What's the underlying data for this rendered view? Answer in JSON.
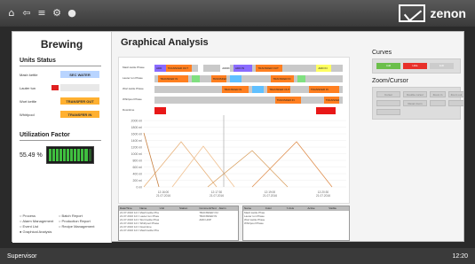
{
  "topbar": {
    "icons": [
      "home-icon",
      "back-icon",
      "menu-icon",
      "gear-icon",
      "user-icon"
    ],
    "brand": "zenon"
  },
  "left": {
    "title": "Brewing",
    "units_title": "Units Status",
    "units": [
      {
        "label": "Mash kettle",
        "status": "SEC WATER",
        "color": "#b8d4ff"
      },
      {
        "label": "Lauter tun",
        "status": "",
        "color": "#e8e8e8",
        "indicator": "#e02020"
      },
      {
        "label": "Wort kettle",
        "status": "TRANSFER OUT",
        "color": "#ffb030"
      },
      {
        "label": "Whirlpool",
        "status": "TRANSFER IN",
        "color": "#ffb030"
      }
    ],
    "util_title": "Utilization Factor",
    "util_value": "55.49 %",
    "util_level": 0.5549,
    "nav": [
      "Process",
      "Batch Report",
      "Alarm Management",
      "Production Report",
      "Event List",
      "Recipe Management",
      "Graphical Analysis"
    ],
    "nav_active": "Graphical Analysis"
  },
  "main": {
    "title": "Graphical Analysis",
    "gantt": [
      {
        "label": "Mash kettle Phase",
        "segments": [
          {
            "s": 0,
            "e": 6,
            "c": "#8a6bff",
            "t": "ADD"
          },
          {
            "s": 6,
            "e": 20,
            "c": "#ff7f20",
            "t": "TRANSFER OUT"
          },
          {
            "s": 23,
            "e": 26,
            "c": "#ffffff",
            "t": ""
          },
          {
            "s": 35,
            "e": 40,
            "c": "#ffffff",
            "t": "ADDIN"
          },
          {
            "s": 42,
            "e": 52,
            "c": "#8a6bff",
            "t": "ADD IN"
          },
          {
            "s": 54,
            "e": 68,
            "c": "#ff7f20",
            "t": "TRANSFER OUT"
          },
          {
            "s": 86,
            "e": 94,
            "c": "#ffff60",
            "t": "ADD IN"
          }
        ]
      },
      {
        "label": "Lauter tun Phase",
        "segments": [
          {
            "s": 2,
            "e": 18,
            "c": "#ff7f20",
            "t": "TRANSFER IN"
          },
          {
            "s": 20,
            "e": 24,
            "c": "#80e080",
            "t": ""
          },
          {
            "s": 30,
            "e": 38,
            "c": "#ff7f20",
            "t": "TRANSFER IN"
          },
          {
            "s": 40,
            "e": 46,
            "c": "#60c0ff",
            "t": ""
          },
          {
            "s": 62,
            "e": 74,
            "c": "#ff7f20",
            "t": "TRANSFER IN"
          },
          {
            "s": 76,
            "e": 80,
            "c": "#80e080",
            "t": ""
          }
        ]
      },
      {
        "label": "Wort kettle Phase",
        "segments": [
          {
            "s": 36,
            "e": 50,
            "c": "#ff7f20",
            "t": "TRANSFER IN"
          },
          {
            "s": 52,
            "e": 58,
            "c": "#60c0ff",
            "t": ""
          },
          {
            "s": 60,
            "e": 72,
            "c": "#ff7f20",
            "t": "TRANSFER OUT"
          },
          {
            "s": 82,
            "e": 98,
            "c": "#ff7f20",
            "t": "TRANSFER IN"
          }
        ]
      },
      {
        "label": "Whirlpool Phase",
        "segments": [
          {
            "s": 64,
            "e": 78,
            "c": "#ff7f20",
            "t": "TRANSFER IN"
          },
          {
            "s": 90,
            "e": 98,
            "c": "#ff7f20",
            "t": "TRANSFER OUT"
          }
        ]
      },
      {
        "label": "Downtime",
        "segments": [
          {
            "s": 0,
            "e": 6,
            "c": "#e81818",
            "t": ""
          },
          {
            "s": 86,
            "e": 96,
            "c": "#e81818",
            "t": ""
          }
        ]
      }
    ],
    "y_ticks": [
      "2000 ml",
      "1800 ml",
      "1600 ml",
      "1400 ml",
      "1200 ml",
      "1000 ml",
      "800 ml",
      "600 ml",
      "400 ml",
      "200 ml",
      "0 ml"
    ],
    "x_ticks": [
      "12:16:00\n21.07.2016",
      "12:17:30\n21.07.2016",
      "12:19:00\n21.07.2016",
      "12:20:30\n21.07.2016"
    ],
    "events_table": {
      "headers": [
        "Date/Time",
        "Name",
        "Unit",
        "Station",
        "Comment/Text",
        "Alarm"
      ],
      "rows": [
        [
          "21.07.2016 12:16:00",
          "Mash kettle Phase 8",
          "",
          "",
          "TRANSFER OUT",
          ""
        ],
        [
          "21.07.2016 12:16:12",
          "Lauter tun Phase 3",
          "",
          "",
          "TRANSFER IN",
          ""
        ],
        [
          "21.07.2016 12:16:45",
          "Wort kettle Phase 2",
          "",
          "",
          "ADD HOP",
          ""
        ],
        [
          "21.07.2016 12:17:02",
          "Whirlpool Phase 1",
          "",
          "",
          "",
          ""
        ],
        [
          "21.07.2016 12:17:30",
          "Downtime",
          "",
          "",
          "",
          ""
        ],
        [
          "21.07.2016 12:18:01",
          "Mash kettle Phase",
          "",
          "",
          "",
          ""
        ]
      ]
    },
    "curves_table": {
      "headers": [
        "Name",
        "Color",
        "Y-Axis",
        "Active",
        "Visible"
      ],
      "rows": [
        [
          "Mash kettle Phase",
          "",
          "",
          "",
          ""
        ],
        [
          "Lauter tun Phase",
          "",
          "",
          "",
          ""
        ],
        [
          "Wort kettle Phase",
          "",
          "",
          "",
          ""
        ],
        [
          "Whirlpool Phase",
          "",
          "",
          "",
          ""
        ]
      ]
    }
  },
  "curves": {
    "title": "Curves",
    "buttons": [
      {
        "label": "Add",
        "color": "#6bbf4a"
      },
      {
        "label": "Hide",
        "color": "#e8302a"
      },
      {
        "label": "Edit",
        "color": "#cccccc"
      }
    ]
  },
  "zoom": {
    "title": "Zoom/Cursor",
    "buttons": [
      "Cursor",
      "Double cursor",
      "Zoom in",
      "Zoom out",
      "",
      "Reset zoom",
      "",
      "",
      ""
    ]
  },
  "statusbar": {
    "user": "Supervisor",
    "time": "12:20"
  }
}
